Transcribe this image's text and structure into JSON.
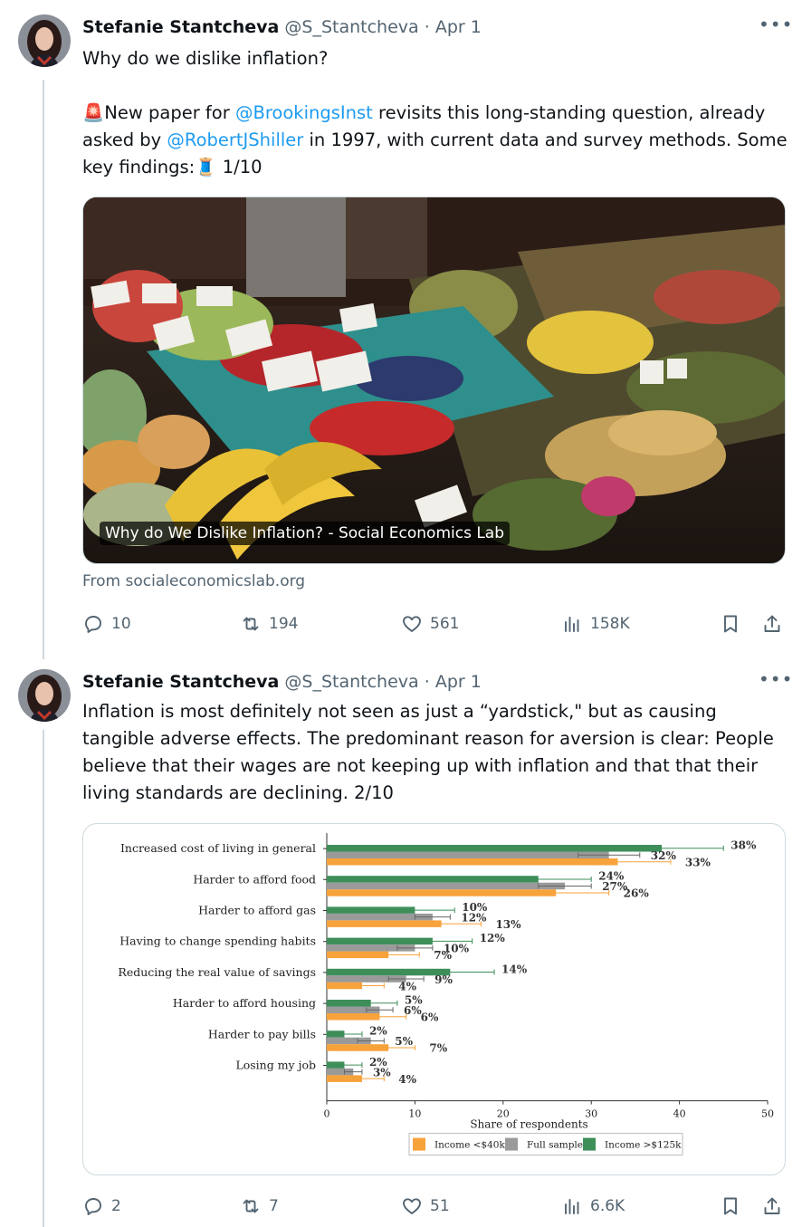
{
  "colors": {
    "link": "#1d9bf0",
    "muted": "#536471",
    "income_low": "#f7a23b",
    "full_sample": "#9a9a9a",
    "income_high": "#3e8e5a"
  },
  "tweets": [
    {
      "author_name": "Stefanie Stantcheva",
      "handle": "@S_Stantcheva",
      "separator": "·",
      "date": "Apr 1",
      "more_icon": "more-horizontal-icon",
      "line1": "Why do we dislike inflation?",
      "alert_emoji": "🚨",
      "text_part1": "New paper for ",
      "mention1": "@BrookingsInst",
      "text_part2": " revisits this long-standing question, already asked by ",
      "mention2": "@RobertJShiller",
      "text_part3": " in 1997, with current data and survey methods. Some key findings:",
      "thread_emoji": "🧵",
      "text_part4": " 1/10",
      "link_card": {
        "caption": "Why do We Dislike Inflation? - Social Economics Lab",
        "source": "From socialeconomicslab.org"
      },
      "stats": {
        "replies": "10",
        "reposts": "194",
        "likes": "561",
        "views": "158K"
      }
    },
    {
      "author_name": "Stefanie Stantcheva",
      "handle": "@S_Stantcheva",
      "separator": "·",
      "date": "Apr 1",
      "more_icon": "more-horizontal-icon",
      "text": "Inflation is most definitely not seen as just a “yardstick,\" but as causing tangible adverse effects. The predominant reason for aversion is clear: People believe that their wages are not keeping up with inflation and that that their living standards are declining. 2/10",
      "stats": {
        "replies": "2",
        "reposts": "7",
        "likes": "51",
        "views": "6.6K"
      }
    }
  ],
  "chart_data": {
    "type": "bar",
    "orientation": "horizontal",
    "xlabel": "Share of respondents",
    "xlim": [
      0,
      50
    ],
    "xticks": [
      "0",
      "10",
      "20",
      "30",
      "40",
      "50"
    ],
    "categories": [
      "Increased cost of living in general",
      "Harder to afford food",
      "Harder to afford gas",
      "Having to change spending habits",
      "Reducing the real value of savings",
      "Harder to afford housing",
      "Harder to pay bills",
      "Losing my job"
    ],
    "series": [
      {
        "name": "Income >$125k",
        "color": "#3e8e5a",
        "values": [
          38,
          24,
          10,
          12,
          14,
          5,
          2,
          2
        ],
        "labels": [
          "38%",
          "24%",
          "10%",
          "12%",
          "14%",
          "5%",
          "2%",
          "2%"
        ],
        "err": [
          7,
          6,
          4.5,
          4.5,
          5,
          3,
          2,
          2
        ]
      },
      {
        "name": "Full sample",
        "color": "#9a9a9a",
        "values": [
          32,
          27,
          12,
          10,
          9,
          6,
          5,
          3
        ],
        "labels": [
          "32%",
          "27%",
          "12%",
          "10%",
          "9%",
          "6%",
          "5%",
          "3%"
        ],
        "err": [
          3.5,
          3,
          2,
          2,
          2,
          1.5,
          1.5,
          1
        ]
      },
      {
        "name": "Income <$40k",
        "color": "#f7a23b",
        "values": [
          33,
          26,
          13,
          7,
          4,
          6,
          7,
          4
        ],
        "labels": [
          "33%",
          "26%",
          "13%",
          "7%",
          "4%",
          "6%",
          "7%",
          "4%"
        ],
        "err": [
          6,
          6,
          4.5,
          3.5,
          2.5,
          3,
          3,
          2.5
        ]
      }
    ],
    "legend": [
      "Income <$40k",
      "Full sample",
      "Income >$125k"
    ],
    "legend_position": "bottom"
  }
}
